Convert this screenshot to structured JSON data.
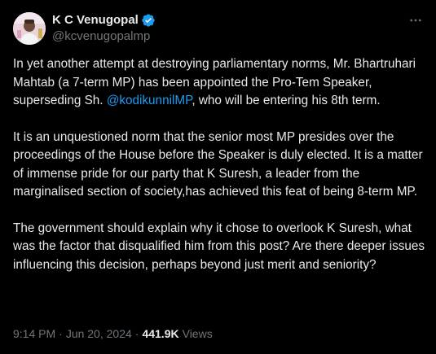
{
  "tweet": {
    "display_name": "K C Venugopal",
    "handle": "@kcvenugopalmp",
    "para1_before": "In yet another attempt at destroying parliamentary norms, Mr. Bhartruhari Mahtab (a 7-term MP) has been appointed the Pro-Tem Speaker, superseding Sh. ",
    "mention": "@kodikunnilMP",
    "para1_after": ", who will be entering his 8th term.",
    "para2": "It is an unquestioned norm that the senior most MP presides over the proceedings of the House before the Speaker is duly elected. It is a matter of immense pride for our party that K Suresh, a leader from the marginalised section of society,has achieved this feat of being 8-term MP.",
    "para3": "The government should explain why it chose to overlook K Suresh, what was the factor that disqualified him from this post? Are there deeper issues influencing this decision, perhaps beyond just merit and seniority?",
    "time": "9:14 PM",
    "separator": "·",
    "date": "Jun 20, 2024",
    "views_count": "441.9K",
    "views_label": "Views"
  },
  "icons": {
    "verified": "verified-badge-icon",
    "more": "more-options-icon"
  },
  "colors": {
    "background": "#000000",
    "text": "#e7e9ea",
    "secondary": "#71767b",
    "accent": "#1d9bf0"
  }
}
